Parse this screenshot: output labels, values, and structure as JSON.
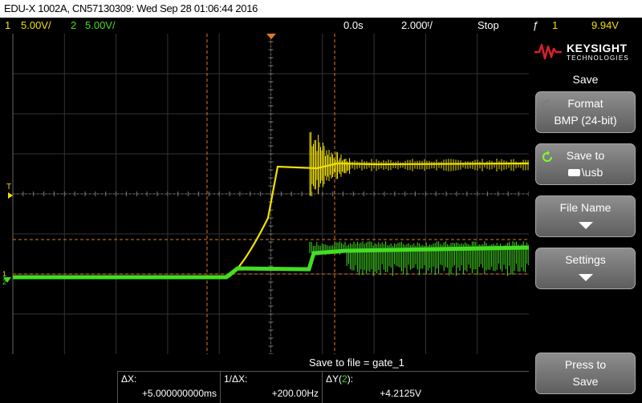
{
  "title": "EDU-X 1002A, CN57130309: Wed Sep 28 01:06:44 2016",
  "status": {
    "ch1_num": "1",
    "ch1_scale": "5.00V/",
    "ch2_num": "2",
    "ch2_scale": "5.00V/",
    "time_pos": "0.0s",
    "time_scale": "2.000ᵗ/",
    "run_state": "Stop",
    "trig_slope": "ƒ",
    "trig_channel": "1",
    "trig_level": "9.94V"
  },
  "markers": {
    "trigger": "T",
    "ch1": "1",
    "ch2": "2"
  },
  "bottom": {
    "save_message": "Save to file = gate_1",
    "delta_x_label": "ΔX:",
    "delta_x_value": "+5.000000000ms",
    "inv_delta_x_label": "1/ΔX:",
    "inv_delta_x_value": "+200.00Hz",
    "delta_y_label": "ΔY(",
    "delta_y_channel": "2",
    "delta_y_label_end": "):",
    "delta_y_value": "+4.2125V"
  },
  "sidebar": {
    "logo_name": "KEYSIGHT",
    "logo_sub": "TECHNOLOGIES",
    "menu_title": "Save",
    "softkeys": [
      {
        "line1": "Format",
        "line2": "BMP (24-bit)"
      },
      {
        "line1": "Save to",
        "line2": "\\usb"
      },
      {
        "line1": "File Name"
      },
      {
        "line1": "Settings"
      },
      {
        "line1": "Press to",
        "line2": "Save"
      }
    ]
  },
  "colors": {
    "channel1": "#f0e000",
    "channel2": "#44dd22",
    "cursor": "#e07a1e",
    "brand": "#d4202c"
  }
}
